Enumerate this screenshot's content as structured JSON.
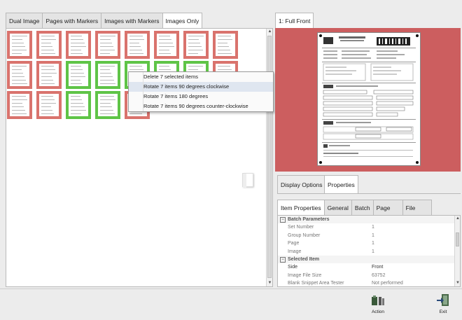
{
  "left_tabs": [
    "Dual Image",
    "Pages with Markers",
    "Images with Markers",
    "Images Only"
  ],
  "active_left_tab": "Images Only",
  "right_tab": "1: Full Front",
  "context_menu": [
    "Delete 7 selected items",
    "Rotate 7 items 90 degrees clockwise",
    "Rotate 7 items 180 degrees",
    "Rotate 7 items 90 degrees counter-clockwise"
  ],
  "thumbnails": {
    "rows": 3,
    "row_counts": [
      8,
      8,
      5
    ],
    "selected": [
      [
        1,
        2
      ],
      [
        1,
        3
      ],
      [
        1,
        4
      ],
      [
        1,
        5
      ],
      [
        1,
        6
      ],
      [
        2,
        2
      ],
      [
        2,
        3
      ]
    ]
  },
  "options_tabs": [
    "Display Options",
    "Properties"
  ],
  "property_tabs": [
    "Item Properties",
    "General",
    "Batch",
    "Page",
    "File"
  ],
  "properties": [
    {
      "group": "Batch Parameters"
    },
    {
      "key": "Set Number",
      "value": "1"
    },
    {
      "key": "Group Number",
      "value": "1"
    },
    {
      "key": "Page",
      "value": "1"
    },
    {
      "key": "Image",
      "value": "1"
    },
    {
      "group": "Selected Item"
    },
    {
      "key": "Side",
      "value": "Front"
    },
    {
      "key": "Image File Size",
      "value": "63752"
    },
    {
      "key": "Blank Snippet Area Tester",
      "value": "Not performed"
    }
  ],
  "buttons": {
    "action": "Action",
    "exit": "Exit"
  },
  "colors": {
    "unselected_border": "#d9736d",
    "selected_border": "#5fc447",
    "preview_bg": "#cc5e5f"
  }
}
